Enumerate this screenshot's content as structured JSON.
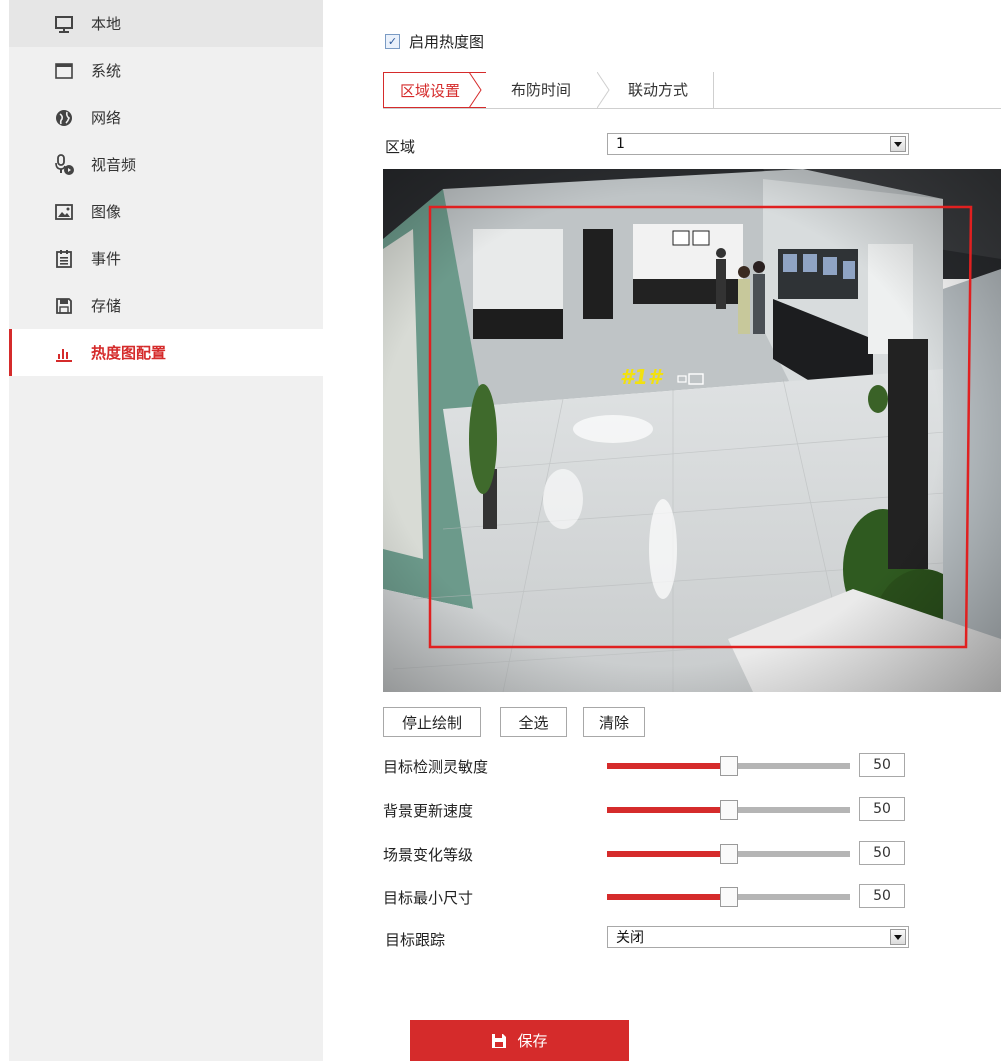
{
  "sidebar": {
    "items": [
      {
        "label": "本地",
        "icon": "monitor-icon"
      },
      {
        "label": "系统",
        "icon": "window-icon"
      },
      {
        "label": "网络",
        "icon": "globe-icon"
      },
      {
        "label": "视音频",
        "icon": "mic-camera-icon"
      },
      {
        "label": "图像",
        "icon": "image-icon"
      },
      {
        "label": "事件",
        "icon": "calendar-icon"
      },
      {
        "label": "存储",
        "icon": "floppy-disk-icon"
      },
      {
        "label": "热度图配置",
        "icon": "bar-chart-icon",
        "active": true
      }
    ]
  },
  "enable_heatmap": {
    "label": "启用热度图",
    "checked": true
  },
  "tabs": [
    {
      "label": "区域设置",
      "active": true
    },
    {
      "label": "布防时间",
      "active": false
    },
    {
      "label": "联动方式",
      "active": false
    }
  ],
  "region": {
    "label": "区域",
    "value": "1"
  },
  "video": {
    "zone_label": "#1#"
  },
  "buttons": {
    "stop_draw": "停止绘制",
    "select_all": "全选",
    "clear": "清除"
  },
  "sliders": [
    {
      "label": "目标检测灵敏度",
      "value": "50",
      "fraction": 0.5
    },
    {
      "label": "背景更新速度",
      "value": "50",
      "fraction": 0.5
    },
    {
      "label": "场景变化等级",
      "value": "50",
      "fraction": 0.5
    },
    {
      "label": "目标最小尺寸",
      "value": "50",
      "fraction": 0.5
    }
  ],
  "tracking": {
    "label": "目标跟踪",
    "value": "关闭"
  },
  "save": {
    "label": "保存"
  },
  "colors": {
    "accent": "#d52b2b",
    "sidebar_bg": "#f0f0f0"
  }
}
